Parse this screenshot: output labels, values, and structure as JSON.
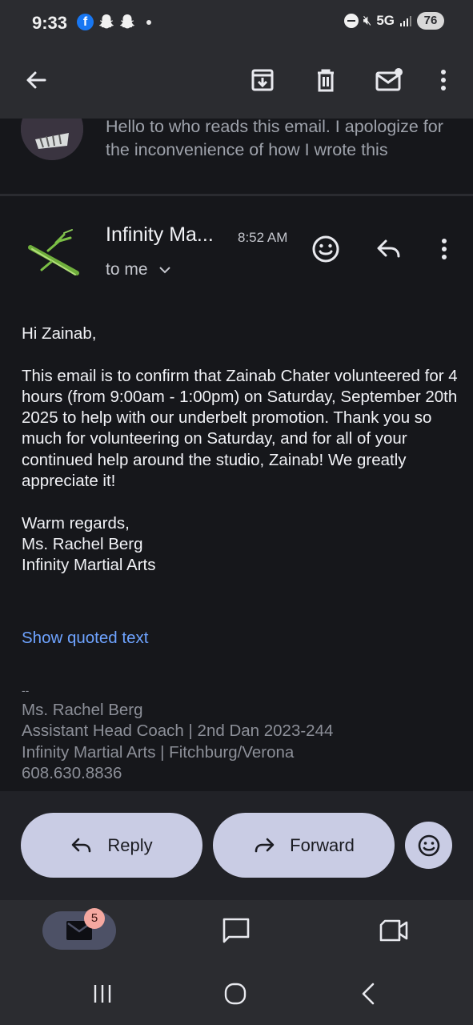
{
  "status_bar": {
    "time": "9:33",
    "network": "5G",
    "battery": "76",
    "icons": [
      "facebook-icon",
      "snapchat-icon",
      "snapchat-icon",
      "dot-icon",
      "do-not-disturb-icon",
      "mute-icon",
      "signal-icon"
    ]
  },
  "toolbar": {
    "icons": [
      "back-arrow-icon",
      "archive-icon",
      "delete-icon",
      "mark-unread-icon",
      "more-vert-icon"
    ]
  },
  "previous_message": {
    "snippet": "Hello to who reads this email. I apologize for the inconvenience of how I wrote this"
  },
  "message": {
    "sender": "Infinity Ma...",
    "time": "8:52 AM",
    "to": "to me",
    "greeting": "Hi Zainab,",
    "paragraph": "This email is to confirm that Zainab Chater volunteered for 4 hours (from 9:00am - 1:00pm) on Saturday, September 20th 2025 to help with our underbelt promotion. Thank you so much for volunteering on Saturday, and for all of your continued help around the studio, Zainab!  We greatly appreciate it!",
    "closing": "Warm regards,",
    "closing_name": "Ms. Rachel Berg",
    "closing_org": "Infinity Martial Arts",
    "show_quoted": "Show quoted text",
    "signature": {
      "dashes": "--",
      "name": "Ms. Rachel Berg",
      "title": "Assistant Head Coach | 2nd Dan 2023-244",
      "org": "Infinity Martial Arts | Fitchburg/Verona",
      "phone": "608.630.8836"
    }
  },
  "actions": {
    "reply": "Reply",
    "forward": "Forward"
  },
  "bottom_nav": {
    "mail_badge": "5"
  },
  "colors": {
    "background": "#16171b",
    "toolbar": "#2b2c30",
    "pill": "#c9cce4",
    "link": "#6ea3ff",
    "badge": "#f5a8a0"
  }
}
